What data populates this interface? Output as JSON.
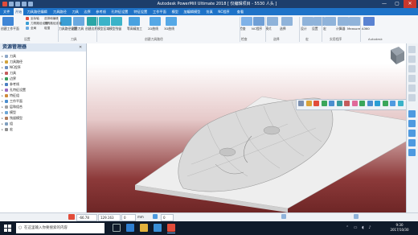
{
  "window": {
    "title": "Autodesk PowerMill Ultimate 2018   [ 仅编辑项目 - 5530 人头 ]",
    "controls": [
      "—",
      "▢",
      "✕"
    ]
  },
  "tabs": [
    "文件",
    "开始",
    "刀具路径编辑",
    "刀具路径",
    "刀具",
    "边界",
    "参考线",
    "孔特征设置",
    "特征设置",
    "工作平面",
    "模型",
    "加编辑模型",
    "仿真",
    "NC程序",
    "查看"
  ],
  "active_tab_index": 1,
  "ribbon": {
    "buttons": [
      {
        "label": "创建工作平面",
        "color": "#3f86d6"
      },
      {
        "label": "刀具路径设置",
        "color": "#3a9ed4"
      },
      {
        "label": "创建刀具",
        "color": "#6aa9e0"
      },
      {
        "label": "创建边界",
        "color": "#2aa6a6"
      },
      {
        "label": "模型区域",
        "color": "#3bb3c9"
      },
      {
        "label": "模型残留",
        "color": "#3bb3c9"
      },
      {
        "label": "等高精加工",
        "color": "#49a2e0"
      },
      {
        "label": "2D曲线",
        "color": "#55a8e6"
      },
      {
        "label": "3D曲线",
        "color": "#55a8e6"
      },
      {
        "label": "检查",
        "color": "#7fb2e8"
      },
      {
        "label": "NC程序",
        "color": "#6f9fd6"
      },
      {
        "label": "模式",
        "color": "#8fb3da"
      },
      {
        "label": "选择",
        "color": "#8fb3da"
      },
      {
        "label": "设计",
        "color": "#8fb3da"
      },
      {
        "label": "设置",
        "color": "#8fb3da"
      },
      {
        "label": "宏",
        "color": "#8fb3da"
      },
      {
        "label": "计算器",
        "color": "#8fb3da"
      },
      {
        "label": "Measure",
        "color": "#8fb3da"
      },
      {
        "label": "A360",
        "color": "#5a83d2"
      }
    ],
    "small_rows": [
      "坐标轴",
      "刀具路径设置",
      "全局",
      "选择和编辑",
      "刀具路径连接",
      "碰撞"
    ],
    "group_labels": [
      "设置",
      "刀具",
      "创建刀具路径",
      "检查",
      "选择",
      "宏",
      "实用程序",
      "Autodesk"
    ]
  },
  "explorer": {
    "title": "资源管理器",
    "items": [
      {
        "label": "刀具",
        "color": "#8da7c8"
      },
      {
        "label": "刀具路径",
        "color": "#d1a33a"
      },
      {
        "label": "NC程序",
        "color": "#6c8fc0"
      },
      {
        "label": "刀具",
        "color": "#c45c5c"
      },
      {
        "label": "边界",
        "color": "#3a9c5a"
      },
      {
        "label": "参考线",
        "color": "#4a7fc2"
      },
      {
        "label": "孔特征设置",
        "color": "#9b6bc2"
      },
      {
        "label": "特征组",
        "color": "#d08a3a"
      },
      {
        "label": "工作平面",
        "color": "#4b8ecf"
      },
      {
        "label": "层和组合",
        "color": "#a0a0a0"
      },
      {
        "label": "模型",
        "color": "#6ca6d6"
      },
      {
        "label": "残留模型",
        "color": "#b07a5a"
      },
      {
        "label": "组",
        "color": "#7f9fbf"
      },
      {
        "label": "宏",
        "color": "#8f8f8f"
      }
    ]
  },
  "status": {
    "coords": [
      "-66.78",
      "129.163",
      "0"
    ],
    "unit": "mm",
    "tool_diam": "0"
  },
  "taskbar": {
    "search_placeholder": "在这里输入你要搜索的内容",
    "time": "9:30",
    "date": "2017/10/30"
  }
}
